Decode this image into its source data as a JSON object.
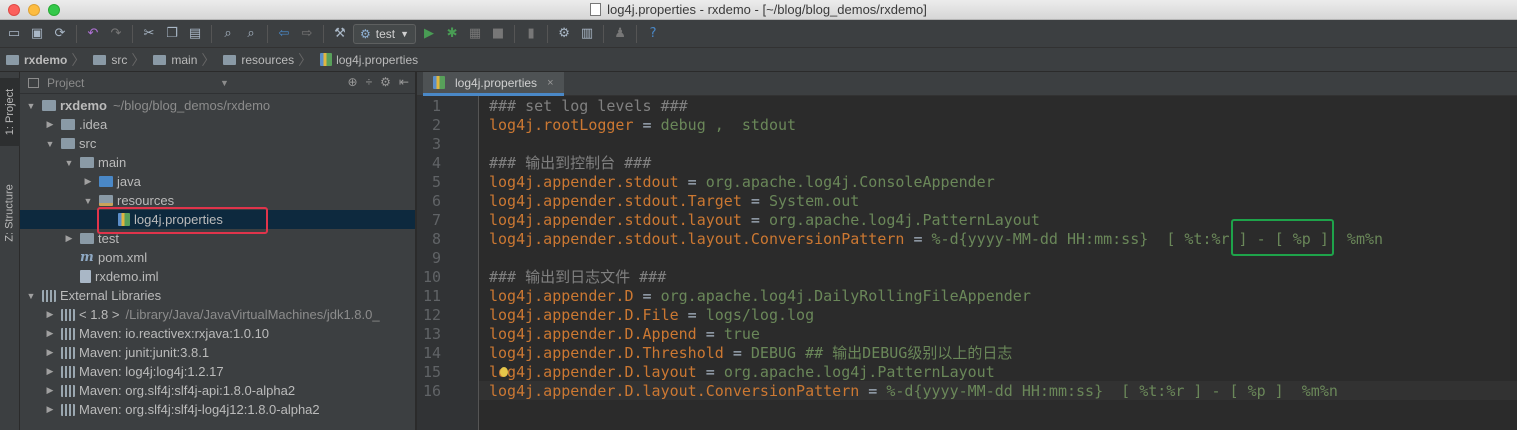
{
  "window": {
    "title": "log4j.properties - rxdemo - [~/blog/blog_demos/rxdemo]"
  },
  "toolbar": {
    "run_config": "test",
    "icons": [
      "open-icon",
      "save-icon",
      "sync-icon",
      "undo-icon",
      "redo-icon",
      "cut-icon",
      "copy-icon",
      "paste-icon",
      "find-icon",
      "replace-icon",
      "back-icon",
      "forward-icon",
      "build-icon",
      "run-config-icon",
      "run-icon",
      "debug-icon",
      "coverage-icon",
      "stop-icon",
      "vcs-icon",
      "settings-icon",
      "structure-icon",
      "sdk-icon",
      "help-icon"
    ]
  },
  "breadcrumb": [
    "rxdemo",
    "src",
    "main",
    "resources",
    "log4j.properties"
  ],
  "left_strip": {
    "project_tab": "1: Project",
    "structure_tab": "Z: Structure"
  },
  "project_panel": {
    "header": "Project",
    "tree": [
      {
        "label": "rxdemo",
        "extra": "~/blog/blog_demos/rxdemo",
        "indent": 0,
        "arrow": "▼",
        "icon": "folder"
      },
      {
        "label": ".idea",
        "indent": 1,
        "arrow": "▶",
        "icon": "folder"
      },
      {
        "label": "src",
        "indent": 1,
        "arrow": "▼",
        "icon": "folder"
      },
      {
        "label": "main",
        "indent": 2,
        "arrow": "▼",
        "icon": "folder"
      },
      {
        "label": "java",
        "indent": 3,
        "arrow": "▶",
        "icon": "folder-blue"
      },
      {
        "label": "resources",
        "indent": 3,
        "arrow": "▼",
        "icon": "res"
      },
      {
        "label": "log4j.properties",
        "indent": 4,
        "arrow": "",
        "icon": "props",
        "selected": true
      },
      {
        "label": "test",
        "indent": 2,
        "arrow": "▶",
        "icon": "folder"
      },
      {
        "label": "pom.xml",
        "indent": 2,
        "arrow": "",
        "icon": "m"
      },
      {
        "label": "rxdemo.iml",
        "indent": 2,
        "arrow": "",
        "icon": "file"
      },
      {
        "label": "External Libraries",
        "indent": 0,
        "arrow": "▼",
        "icon": "lib"
      },
      {
        "label": "< 1.8 >",
        "extra": "/Library/Java/JavaVirtualMachines/jdk1.8.0_",
        "indent": 1,
        "arrow": "▶",
        "icon": "lib"
      },
      {
        "label": "Maven: io.reactivex:rxjava:1.0.10",
        "indent": 1,
        "arrow": "▶",
        "icon": "lib"
      },
      {
        "label": "Maven: junit:junit:3.8.1",
        "indent": 1,
        "arrow": "▶",
        "icon": "lib"
      },
      {
        "label": "Maven: log4j:log4j:1.2.17",
        "indent": 1,
        "arrow": "▶",
        "icon": "lib"
      },
      {
        "label": "Maven: org.slf4j:slf4j-api:1.8.0-alpha2",
        "indent": 1,
        "arrow": "▶",
        "icon": "lib"
      },
      {
        "label": "Maven: org.slf4j:slf4j-log4j12:1.8.0-alpha2",
        "indent": 1,
        "arrow": "▶",
        "icon": "lib"
      }
    ]
  },
  "editor": {
    "tab": "log4j.properties",
    "lines": [
      {
        "n": "1",
        "parts": [
          [
            "c",
            "### set log levels ###"
          ]
        ]
      },
      {
        "n": "2",
        "parts": [
          [
            "k",
            "log4j.rootLogger"
          ],
          [
            "",
            " = "
          ],
          [
            "v",
            "debug ,  stdout"
          ]
        ]
      },
      {
        "n": "3",
        "parts": []
      },
      {
        "n": "4",
        "parts": [
          [
            "c",
            "### 输出到控制台 ###"
          ]
        ]
      },
      {
        "n": "5",
        "parts": [
          [
            "k",
            "log4j.appender.stdout"
          ],
          [
            "",
            " = "
          ],
          [
            "v",
            "org.apache.log4j.ConsoleAppender"
          ]
        ]
      },
      {
        "n": "6",
        "parts": [
          [
            "k",
            "log4j.appender.stdout.Target"
          ],
          [
            "",
            " = "
          ],
          [
            "v",
            "System.out"
          ]
        ]
      },
      {
        "n": "7",
        "parts": [
          [
            "k",
            "log4j.appender.stdout.layout"
          ],
          [
            "",
            " = "
          ],
          [
            "v",
            "org.apache.log4j.PatternLayout"
          ]
        ]
      },
      {
        "n": "8",
        "parts": [
          [
            "k",
            "log4j.appender.stdout.layout.ConversionPattern"
          ],
          [
            "",
            " = "
          ],
          [
            "v",
            "%-d{yyyy-MM-dd HH:mm:ss}  [ %t:%r ] - [ %p ]  %m%n"
          ]
        ]
      },
      {
        "n": "9",
        "parts": []
      },
      {
        "n": "10",
        "parts": [
          [
            "c",
            "### 输出到日志文件 ###"
          ]
        ]
      },
      {
        "n": "11",
        "parts": [
          [
            "k",
            "log4j.appender.D"
          ],
          [
            "",
            " = "
          ],
          [
            "v",
            "org.apache.log4j.DailyRollingFileAppender"
          ]
        ]
      },
      {
        "n": "12",
        "parts": [
          [
            "k",
            "log4j.appender.D.File"
          ],
          [
            "",
            " = "
          ],
          [
            "v",
            "logs/log.log"
          ]
        ]
      },
      {
        "n": "13",
        "parts": [
          [
            "k",
            "log4j.appender.D.Append"
          ],
          [
            "",
            " = "
          ],
          [
            "v",
            "true"
          ]
        ]
      },
      {
        "n": "14",
        "parts": [
          [
            "k",
            "log4j.appender.D.Threshold"
          ],
          [
            "",
            " = "
          ],
          [
            "v",
            "DEBUG ## 输出DEBUG级别以上的日志"
          ]
        ]
      },
      {
        "n": "15",
        "parts": [
          [
            "k",
            "log4j.appender.D.layout"
          ],
          [
            "",
            " = "
          ],
          [
            "v",
            "org.apache.log4j.PatternLayout"
          ]
        ]
      },
      {
        "n": "16",
        "parts": [
          [
            "k",
            "log4j.appender.D.layout.ConversionPattern"
          ],
          [
            "",
            " = "
          ],
          [
            "v",
            "%-d{yyyy-MM-dd HH:mm:ss}  [ %t:%r ] - [ %p ]  %m%n"
          ]
        ]
      }
    ]
  },
  "colors": {
    "keyword": "#cc7832",
    "value": "#6a8759",
    "comment": "#808080",
    "selection": "#0d293e",
    "highlight_red": "#e0344b",
    "highlight_green": "#1ea34a"
  }
}
